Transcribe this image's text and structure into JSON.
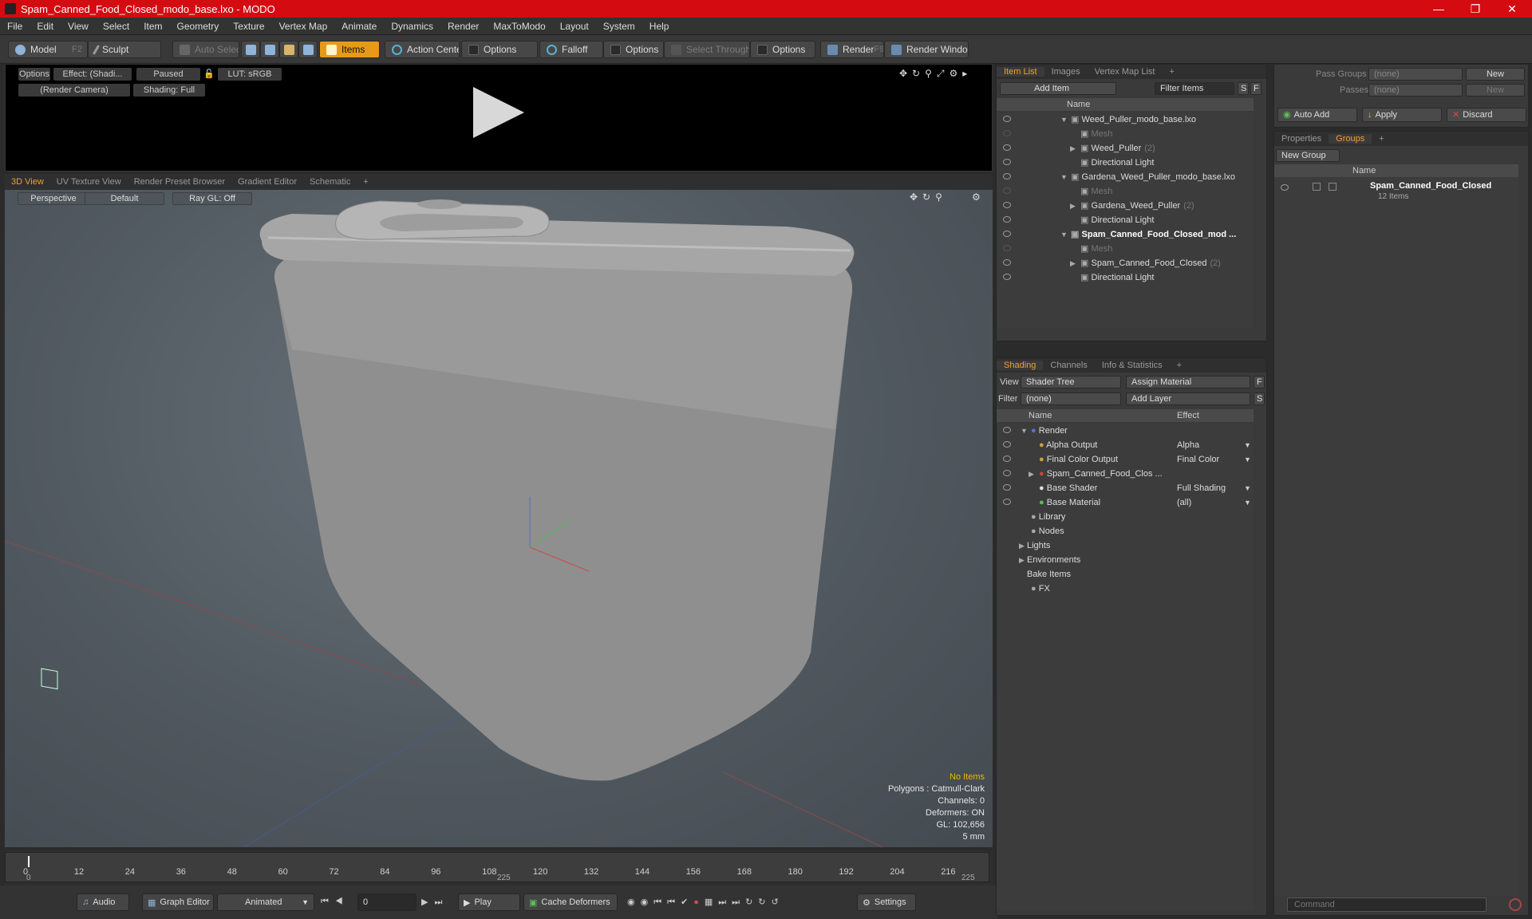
{
  "window": {
    "title": "Spam_Canned_Food_Closed_modo_base.lxo - MODO"
  },
  "menu": [
    "File",
    "Edit",
    "View",
    "Select",
    "Item",
    "Geometry",
    "Texture",
    "Vertex Map",
    "Animate",
    "Dynamics",
    "Render",
    "MaxToModo",
    "Layout",
    "System",
    "Help"
  ],
  "toolbar": {
    "model": "Model",
    "model_key": "F2",
    "sculpt": "Sculpt",
    "auto_select": "Auto Select",
    "items": "Items",
    "action_center": "Action Center",
    "options1": "Options",
    "falloff": "Falloff",
    "options2": "Options",
    "select_through": "Select Through",
    "options3": "Options",
    "render": "Render",
    "render_key": "F9",
    "render_window": "Render Window"
  },
  "preview": {
    "options": "Options",
    "effect": "Effect: (Shadi...",
    "paused": "Paused",
    "lut": "LUT: sRGB",
    "camera": "(Render Camera)",
    "shading": "Shading: Full"
  },
  "viewport_tabs": [
    "3D View",
    "UV Texture View",
    "Render Preset Browser",
    "Gradient Editor",
    "Schematic",
    "+"
  ],
  "viewport": {
    "projection": "Perspective",
    "style": "Default",
    "raygl": "Ray GL: Off",
    "stats": {
      "selection": "No Items",
      "polygons": "Polygons : Catmull-Clark",
      "channels": "Channels: 0",
      "deformers": "Deformers: ON",
      "gl": "GL: 102,656",
      "units": "5 mm"
    }
  },
  "timeline": {
    "ticks": [
      "0",
      "12",
      "24",
      "36",
      "48",
      "60",
      "72",
      "84",
      "96",
      "108",
      "120",
      "132",
      "144",
      "156",
      "168",
      "180",
      "192",
      "204",
      "216"
    ],
    "start": "0",
    "mid": "225",
    "end": "225"
  },
  "bottombar": {
    "audio": "Audio",
    "graph_editor": "Graph Editor",
    "animated": "Animated",
    "frame": "0",
    "play": "Play",
    "cache_deformers": "Cache Deformers",
    "settings": "Settings"
  },
  "item_list": {
    "tabs": [
      "Item List",
      "Images",
      "Vertex Map List",
      "+"
    ],
    "add_item": "Add Item",
    "filter_items": "Filter Items",
    "col_name": "Name",
    "rows": [
      {
        "label": "Weed_Puller_modo_base.lxo",
        "count": "",
        "style": "normal",
        "indent": 1,
        "arrow": "▼"
      },
      {
        "label": "Mesh",
        "count": "",
        "style": "dim",
        "indent": 2,
        "arrow": ""
      },
      {
        "label": "Weed_Puller",
        "count": "(2)",
        "style": "normal",
        "indent": 2,
        "arrow": "▶"
      },
      {
        "label": "Directional Light",
        "count": "",
        "style": "normal",
        "indent": 2,
        "arrow": ""
      },
      {
        "label": "Gardena_Weed_Puller_modo_base.lxo",
        "count": "",
        "style": "normal",
        "indent": 1,
        "arrow": "▼"
      },
      {
        "label": "Mesh",
        "count": "",
        "style": "dim",
        "indent": 2,
        "arrow": ""
      },
      {
        "label": "Gardena_Weed_Puller",
        "count": "(2)",
        "style": "normal",
        "indent": 2,
        "arrow": "▶"
      },
      {
        "label": "Directional Light",
        "count": "",
        "style": "normal",
        "indent": 2,
        "arrow": ""
      },
      {
        "label": "Spam_Canned_Food_Closed_mod ...",
        "count": "",
        "style": "bold",
        "indent": 1,
        "arrow": "▼"
      },
      {
        "label": "Mesh",
        "count": "",
        "style": "dim",
        "indent": 2,
        "arrow": ""
      },
      {
        "label": "Spam_Canned_Food_Closed",
        "count": "(2)",
        "style": "normal",
        "indent": 2,
        "arrow": "▶"
      },
      {
        "label": "Directional Light",
        "count": "",
        "style": "normal",
        "indent": 2,
        "arrow": ""
      }
    ]
  },
  "shading": {
    "tabs": [
      "Shading",
      "Channels",
      "Info & Statistics",
      "+"
    ],
    "view_label": "View",
    "view_value": "Shader Tree",
    "assign_material": "Assign Material",
    "filter_label": "Filter",
    "filter_value": "(none)",
    "add_layer": "Add Layer",
    "col_name": "Name",
    "col_effect": "Effect",
    "rows": [
      {
        "label": "Render",
        "effect": "",
        "indent": 0,
        "arrow": "▼"
      },
      {
        "label": "Alpha Output",
        "effect": "Alpha",
        "indent": 1,
        "arrow": ""
      },
      {
        "label": "Final Color Output",
        "effect": "Final Color",
        "indent": 1,
        "arrow": ""
      },
      {
        "label": "Spam_Canned_Food_Clos ...",
        "effect": "",
        "indent": 1,
        "arrow": "▶"
      },
      {
        "label": "Base Shader",
        "effect": "Full Shading",
        "indent": 1,
        "arrow": ""
      },
      {
        "label": "Base Material",
        "effect": "(all)",
        "indent": 1,
        "arrow": ""
      },
      {
        "label": "Library",
        "effect": "",
        "indent": 0,
        "arrow": ""
      },
      {
        "label": "Nodes",
        "effect": "",
        "indent": 0,
        "arrow": ""
      },
      {
        "label": "Lights",
        "effect": "",
        "indent": -1,
        "arrow": "▶"
      },
      {
        "label": "Environments",
        "effect": "",
        "indent": -1,
        "arrow": "▶"
      },
      {
        "label": "Bake Items",
        "effect": "",
        "indent": -1,
        "arrow": ""
      },
      {
        "label": "FX",
        "effect": "",
        "indent": 0,
        "arrow": ""
      }
    ]
  },
  "passes": {
    "pass_groups_label": "Pass Groups",
    "pass_groups_value": "(none)",
    "new1": "New",
    "passes_label": "Passes",
    "passes_value": "(none)",
    "new2": "New",
    "auto_add": "Auto Add",
    "apply": "Apply",
    "discard": "Discard"
  },
  "groups": {
    "tabs": [
      "Properties",
      "Groups",
      "+"
    ],
    "new_group": "New Group",
    "col_name": "Name",
    "item_name": "Spam_Canned_Food_Closed",
    "item_count": "12 Items"
  },
  "command": {
    "placeholder": "Command"
  },
  "colors": {
    "accent": "#f0a030",
    "title_bar": "#d50b12",
    "active_tool": "#e79a17"
  }
}
